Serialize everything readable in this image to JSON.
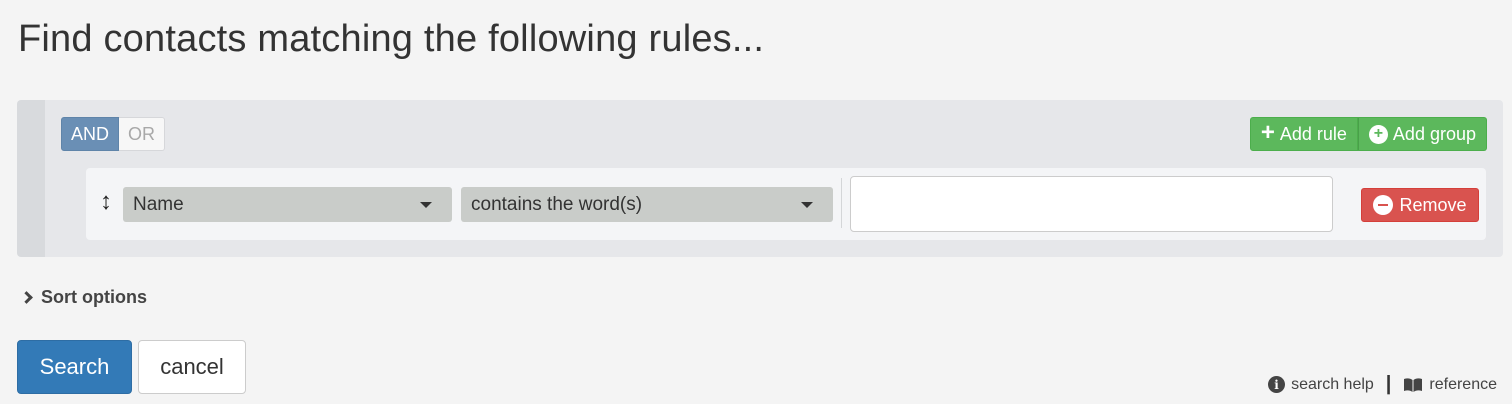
{
  "page": {
    "title": "Find contacts matching the following rules..."
  },
  "builder": {
    "conjunctions": [
      {
        "label": "AND",
        "active": true
      },
      {
        "label": "OR",
        "active": false
      }
    ],
    "add_rule_label": "Add rule",
    "add_group_label": "Add group",
    "rule": {
      "field": "Name",
      "operator": "contains the word(s)",
      "value": "",
      "remove_label": "Remove"
    }
  },
  "sort": {
    "label": "Sort options"
  },
  "actions": {
    "search_label": "Search",
    "cancel_label": "cancel"
  },
  "help": {
    "search_help_label": "search help",
    "separator": "|",
    "reference_label": "reference"
  },
  "colors": {
    "primary": "#337ab7",
    "success": "#5cb85c",
    "danger": "#d9534f",
    "conj_active": "#6a8fb5"
  }
}
